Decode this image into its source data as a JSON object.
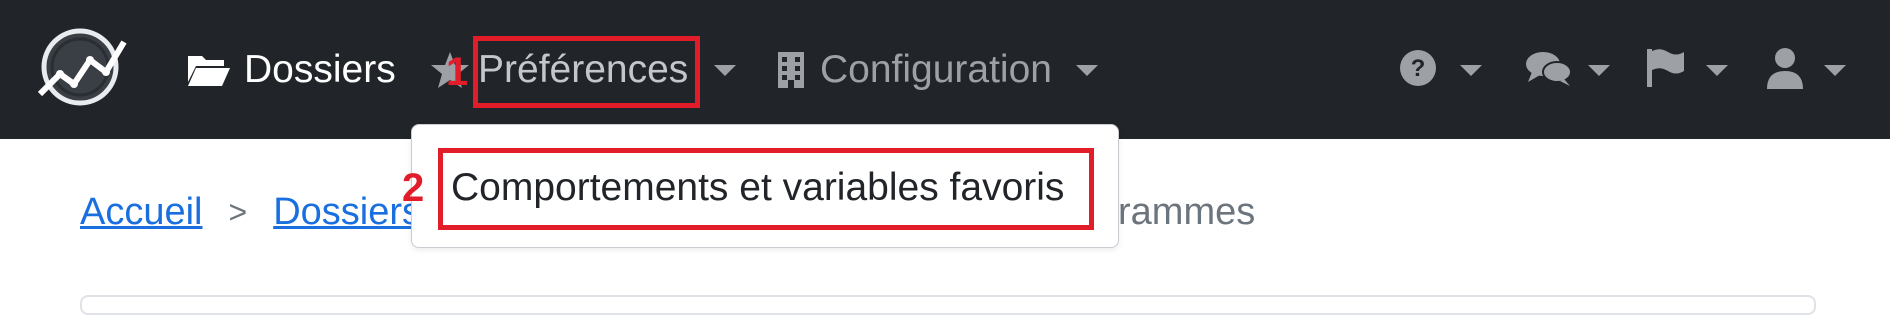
{
  "navbar": {
    "logo_icon": "chart-line-logo-icon",
    "items": [
      {
        "label": "Dossiers",
        "icon": "folder-open-icon"
      },
      {
        "label": "Préférences",
        "icon": "star-icon"
      },
      {
        "label": "Configuration",
        "icon": "building-icon"
      }
    ],
    "right_icons": [
      "question-circle-icon",
      "comments-icon",
      "flag-icon",
      "user-icon"
    ]
  },
  "dropdown": {
    "items": [
      {
        "label": "Comportements et variables favoris"
      }
    ]
  },
  "breadcrumb": {
    "links": [
      "Accueil",
      "Dossiers"
    ],
    "separator": ">",
    "current_visible": "rammes"
  },
  "annotations": {
    "markers": [
      "1",
      "2"
    ],
    "color": "#e11d2a"
  },
  "colors": {
    "navbar_bg": "#212529",
    "link": "#1a6fe0",
    "muted": "#6c757d",
    "highlight": "#e11d2a"
  }
}
